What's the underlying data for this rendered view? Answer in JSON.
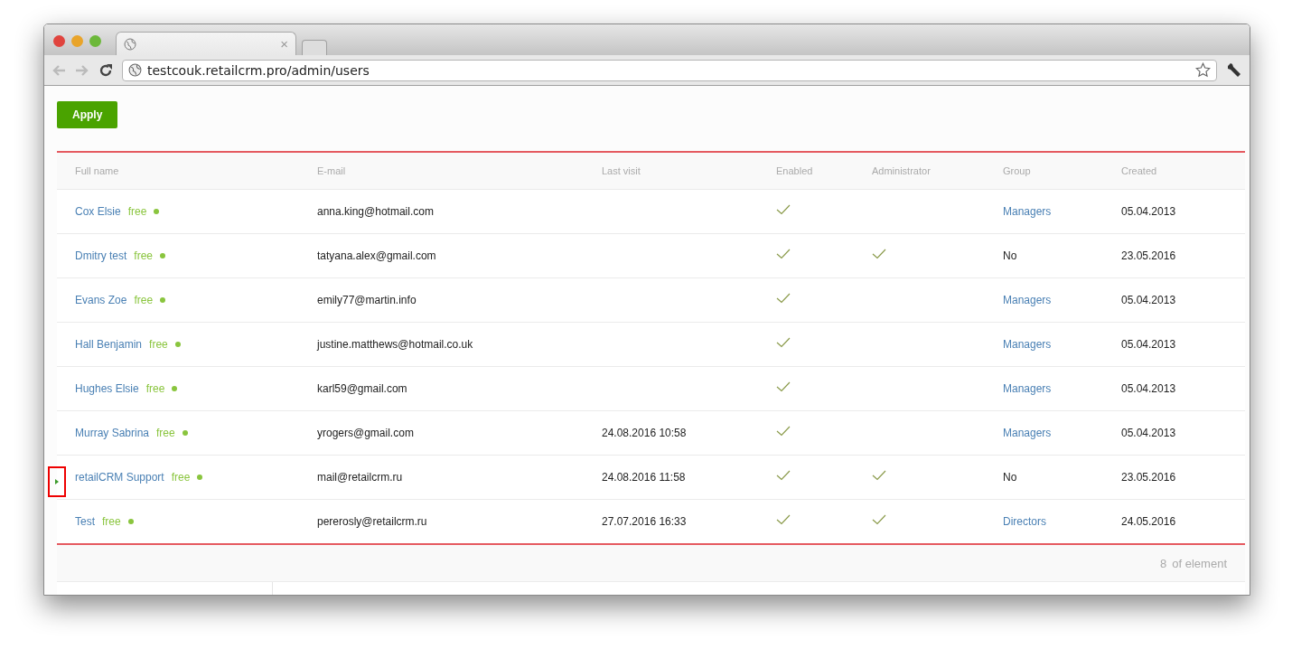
{
  "browser": {
    "url": "testcouk.retailcrm.pro/admin/users",
    "tab_close": "×"
  },
  "apply_button": "Apply",
  "table": {
    "columns": [
      "Full name",
      "E-mail",
      "Last visit",
      "Enabled",
      "Administrator",
      "Group",
      "Created"
    ],
    "rows": [
      {
        "full_name": {
          "name": "Cox Elsie",
          "badge": "free",
          "online": true
        },
        "email": "anna.king@hotmail.com",
        "last_visit": "",
        "enabled": true,
        "administrator": false,
        "group": "Managers",
        "group_link": true,
        "created": "05.04.2013",
        "marked": false
      },
      {
        "full_name": {
          "name": "Dmitry test",
          "badge": "free",
          "online": true
        },
        "email": "tatyana.alex@gmail.com",
        "last_visit": "",
        "enabled": true,
        "administrator": true,
        "group": "No",
        "group_link": false,
        "created": "23.05.2016",
        "marked": false
      },
      {
        "full_name": {
          "name": "Evans Zoe",
          "badge": "free",
          "online": true
        },
        "email": "emily77@martin.info",
        "last_visit": "",
        "enabled": true,
        "administrator": false,
        "group": "Managers",
        "group_link": true,
        "created": "05.04.2013",
        "marked": false
      },
      {
        "full_name": {
          "name": "Hall Benjamin",
          "badge": "free",
          "online": true
        },
        "email": "justine.matthews@hotmail.co.uk",
        "last_visit": "",
        "enabled": true,
        "administrator": false,
        "group": "Managers",
        "group_link": true,
        "created": "05.04.2013",
        "marked": false
      },
      {
        "full_name": {
          "name": "Hughes Elsie",
          "badge": "free",
          "online": true
        },
        "email": "karl59@gmail.com",
        "last_visit": "",
        "enabled": true,
        "administrator": false,
        "group": "Managers",
        "group_link": true,
        "created": "05.04.2013",
        "marked": false
      },
      {
        "full_name": {
          "name": "Murray Sabrina",
          "badge": "free",
          "online": true
        },
        "email": "yrogers@gmail.com",
        "last_visit": "24.08.2016 10:58",
        "enabled": true,
        "administrator": false,
        "group": "Managers",
        "group_link": true,
        "created": "05.04.2013",
        "marked": false
      },
      {
        "full_name": {
          "name": "retailCRM Support",
          "badge": "free",
          "online": true
        },
        "email": "mail@retailcrm.ru",
        "last_visit": "24.08.2016 11:58",
        "enabled": true,
        "administrator": true,
        "group": "No",
        "group_link": false,
        "created": "23.05.2016",
        "marked": true
      },
      {
        "full_name": {
          "name": "Test",
          "badge": "free",
          "online": true
        },
        "email": "pererosly@retailcrm.ru",
        "last_visit": "27.07.2016 16:33",
        "enabled": true,
        "administrator": true,
        "group": "Directors",
        "group_link": true,
        "created": "24.05.2016",
        "marked": false
      }
    ]
  },
  "footer": {
    "count": "8",
    "label": "of element"
  }
}
